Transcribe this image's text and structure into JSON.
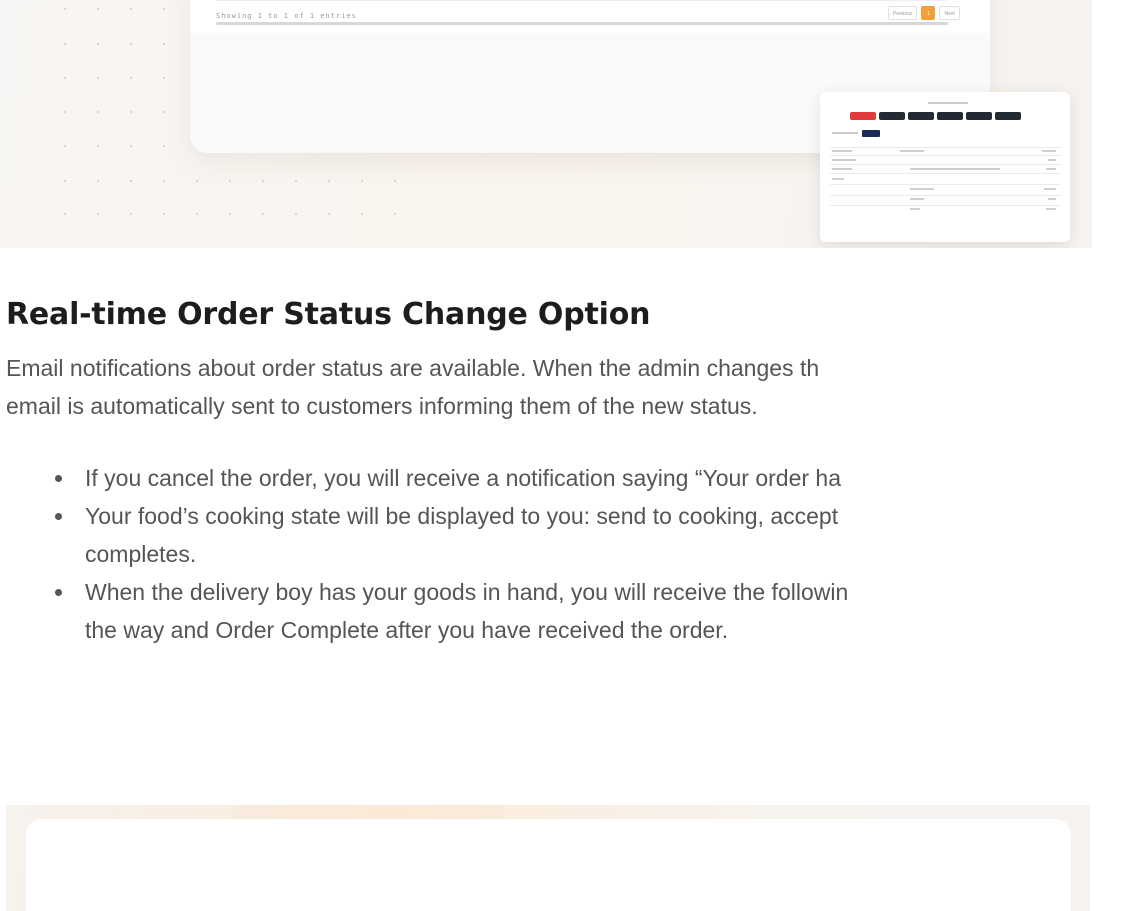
{
  "top_screenshot": {
    "footer_text": "Showing 1 to 1 of 1 entries",
    "pager": {
      "previous": "Previous",
      "current": "1",
      "next": "Next"
    },
    "accent_color": "#f2a03a"
  },
  "article": {
    "heading": "Real-time Order Status Change Option",
    "paragraph_lines": [
      "Email notifications about order status are available. When the admin changes th",
      "email is automatically sent to customers informing them of the new status."
    ],
    "bullets": [
      {
        "lines": [
          "If you cancel the order, you will receive a notification saying “Your order ha"
        ]
      },
      {
        "lines": [
          "Your food’s cooking state will be displayed to you: send to cooking, accept",
          "completes."
        ]
      },
      {
        "lines": [
          "When the delivery boy has your goods in hand, you will receive the followin",
          "the way and Order Complete after you have received the order."
        ]
      }
    ]
  }
}
